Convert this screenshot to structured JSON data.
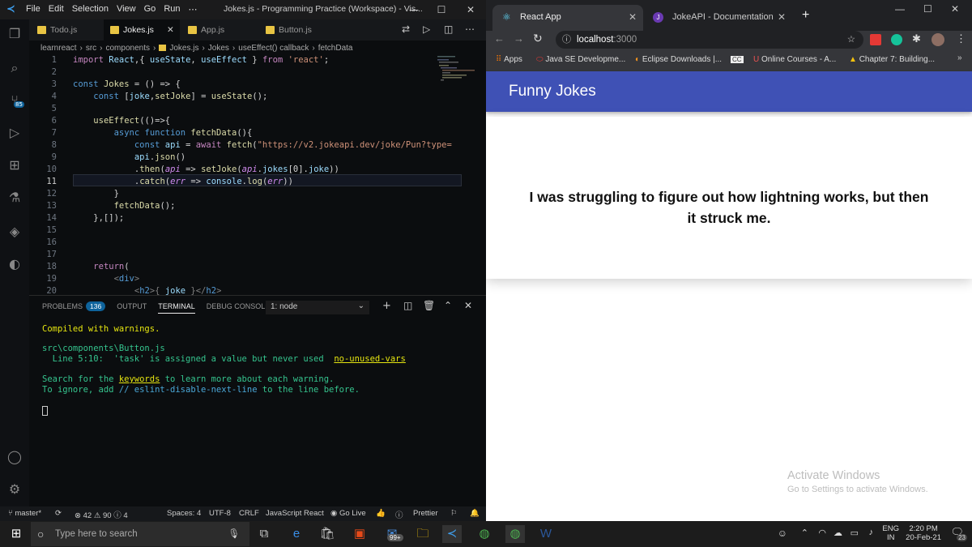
{
  "vscode": {
    "menu": [
      "File",
      "Edit",
      "Selection",
      "View",
      "Go",
      "Run",
      "⋯"
    ],
    "window_title": "Jokes.js - Programming Practice (Workspace) - Vis...",
    "tabs": [
      "Todo.js",
      "Jokes.js",
      "App.js",
      "Button.js"
    ],
    "breadcrumb": [
      "learnreact",
      "src",
      "components",
      "Jokes.js",
      "Jokes",
      "useEffect() callback",
      "fetchData"
    ],
    "line_numbers": [
      "1",
      "2",
      "3",
      "4",
      "5",
      "6",
      "7",
      "8",
      "9",
      "10",
      "11",
      "12",
      "13",
      "14",
      "15",
      "16",
      "17",
      "18",
      "19",
      "20"
    ],
    "code": {
      "l1a": "import ",
      "l1b": "React",
      "l1c": ",{ ",
      "l1d": "useState",
      "l1e": ", ",
      "l1f": "useEffect",
      "l1g": " } ",
      "l1h": "from",
      "l1i": " 'react'",
      "l1j": ";",
      "l3a": "const ",
      "l3b": "Jokes",
      "l3c": " = () => {",
      "l4a": "    const ",
      "l4b": "[",
      "l4c": "joke",
      "l4d": ",",
      "l4e": "setJoke",
      "l4f": "] = ",
      "l4g": "useState",
      "l4h": "();",
      "l6a": "    ",
      "l6b": "useEffect",
      "l6c": "(()=>{",
      "l7a": "        async function ",
      "l7b": "fetchData",
      "l7c": "(){",
      "l8a": "            const ",
      "l8b": "api",
      "l8c": " = ",
      "l8d": "await ",
      "l8e": "fetch",
      "l8f": "(",
      "l8g": "\"https://v2.jokeapi.dev/joke/Pun?type=",
      "l9a": "            ",
      "l9b": "api",
      "l9c": ".",
      "l9d": "json",
      "l9e": "()",
      "l10a": "            .",
      "l10b": "then",
      "l10c": "(",
      "l10d": "api",
      "l10e": " => ",
      "l10f": "setJoke",
      "l10g": "(",
      "l10h": "api",
      "l10i": ".",
      "l10j": "jokes",
      "l10k": "[0].",
      "l10l": "joke",
      "l10m": "))",
      "l11a": "            .",
      "l11b": "catch",
      "l11c": "(",
      "l11d": "err",
      "l11e": " => ",
      "l11f": "console",
      "l11g": ".",
      "l11h": "log",
      "l11i": "(",
      "l11j": "err",
      "l11k": "))",
      "l12": "        }",
      "l13a": "        ",
      "l13b": "fetchData",
      "l13c": "();",
      "l14": "    },[]);",
      "l18a": "    ",
      "l18b": "return",
      "l18c": "(",
      "l19a": "        <",
      "l19b": "div",
      "l19c": ">",
      "l20a": "            <",
      "l20b": "h2",
      "l20c": ">{ ",
      "l20d": "joke",
      "l20e": " }</",
      "l20f": "h2",
      "l20g": ">"
    },
    "panel": {
      "tabs": [
        "PROBLEMS",
        "OUTPUT",
        "TERMINAL",
        "DEBUG CONSOLE"
      ],
      "problems_count": "136",
      "terminal_select": "1: node",
      "lines": {
        "compiled": "Compiled with warnings.",
        "file": "src\\components\\Button.js",
        "warn": "  Line 5:10:  'task' is assigned a value but never used  ",
        "rule": "no-unused-vars",
        "search_a": "Search for the ",
        "search_b": "keywords",
        "search_c": " to learn more about each warning.",
        "ignore_a": "To ignore, add ",
        "ignore_b": "// eslint-disable-next-line",
        "ignore_c": " to the line before."
      }
    },
    "status": {
      "branch": "master*",
      "errors": "42",
      "warnings": "90",
      "info": "4",
      "spaces": "Spaces: 4",
      "encoding": "UTF-8",
      "eol": "CRLF",
      "language": "JavaScript React",
      "golive": "Go Live",
      "prettier": "Prettier"
    }
  },
  "chrome": {
    "tabs": [
      "React App",
      "JokeAPI - Documentation"
    ],
    "url_host": "localhost",
    "url_port": ":3000",
    "bookmarks": [
      "Apps",
      "Java SE Developme...",
      "Eclipse Downloads |...",
      "Online Courses - A...",
      "Chapter 7: Building..."
    ],
    "app": {
      "title": "Funny Jokes",
      "joke": "I was struggling to figure out how lightning works, but then it struck me."
    },
    "watermark": {
      "title": "Activate Windows",
      "subtitle": "Go to Settings to activate Windows."
    }
  },
  "taskbar": {
    "search_placeholder": "Type here to search",
    "mail_badge": "99+",
    "lang1": "ENG",
    "lang2": "IN",
    "time": "2:20 PM",
    "date": "20-Feb-21",
    "notif_count": "23"
  },
  "colors": {
    "accent": "#3f51b5",
    "vscode_bg": "#0b0d0f",
    "terminal_yellow": "#e5e510",
    "terminal_green": "#35c48e"
  }
}
